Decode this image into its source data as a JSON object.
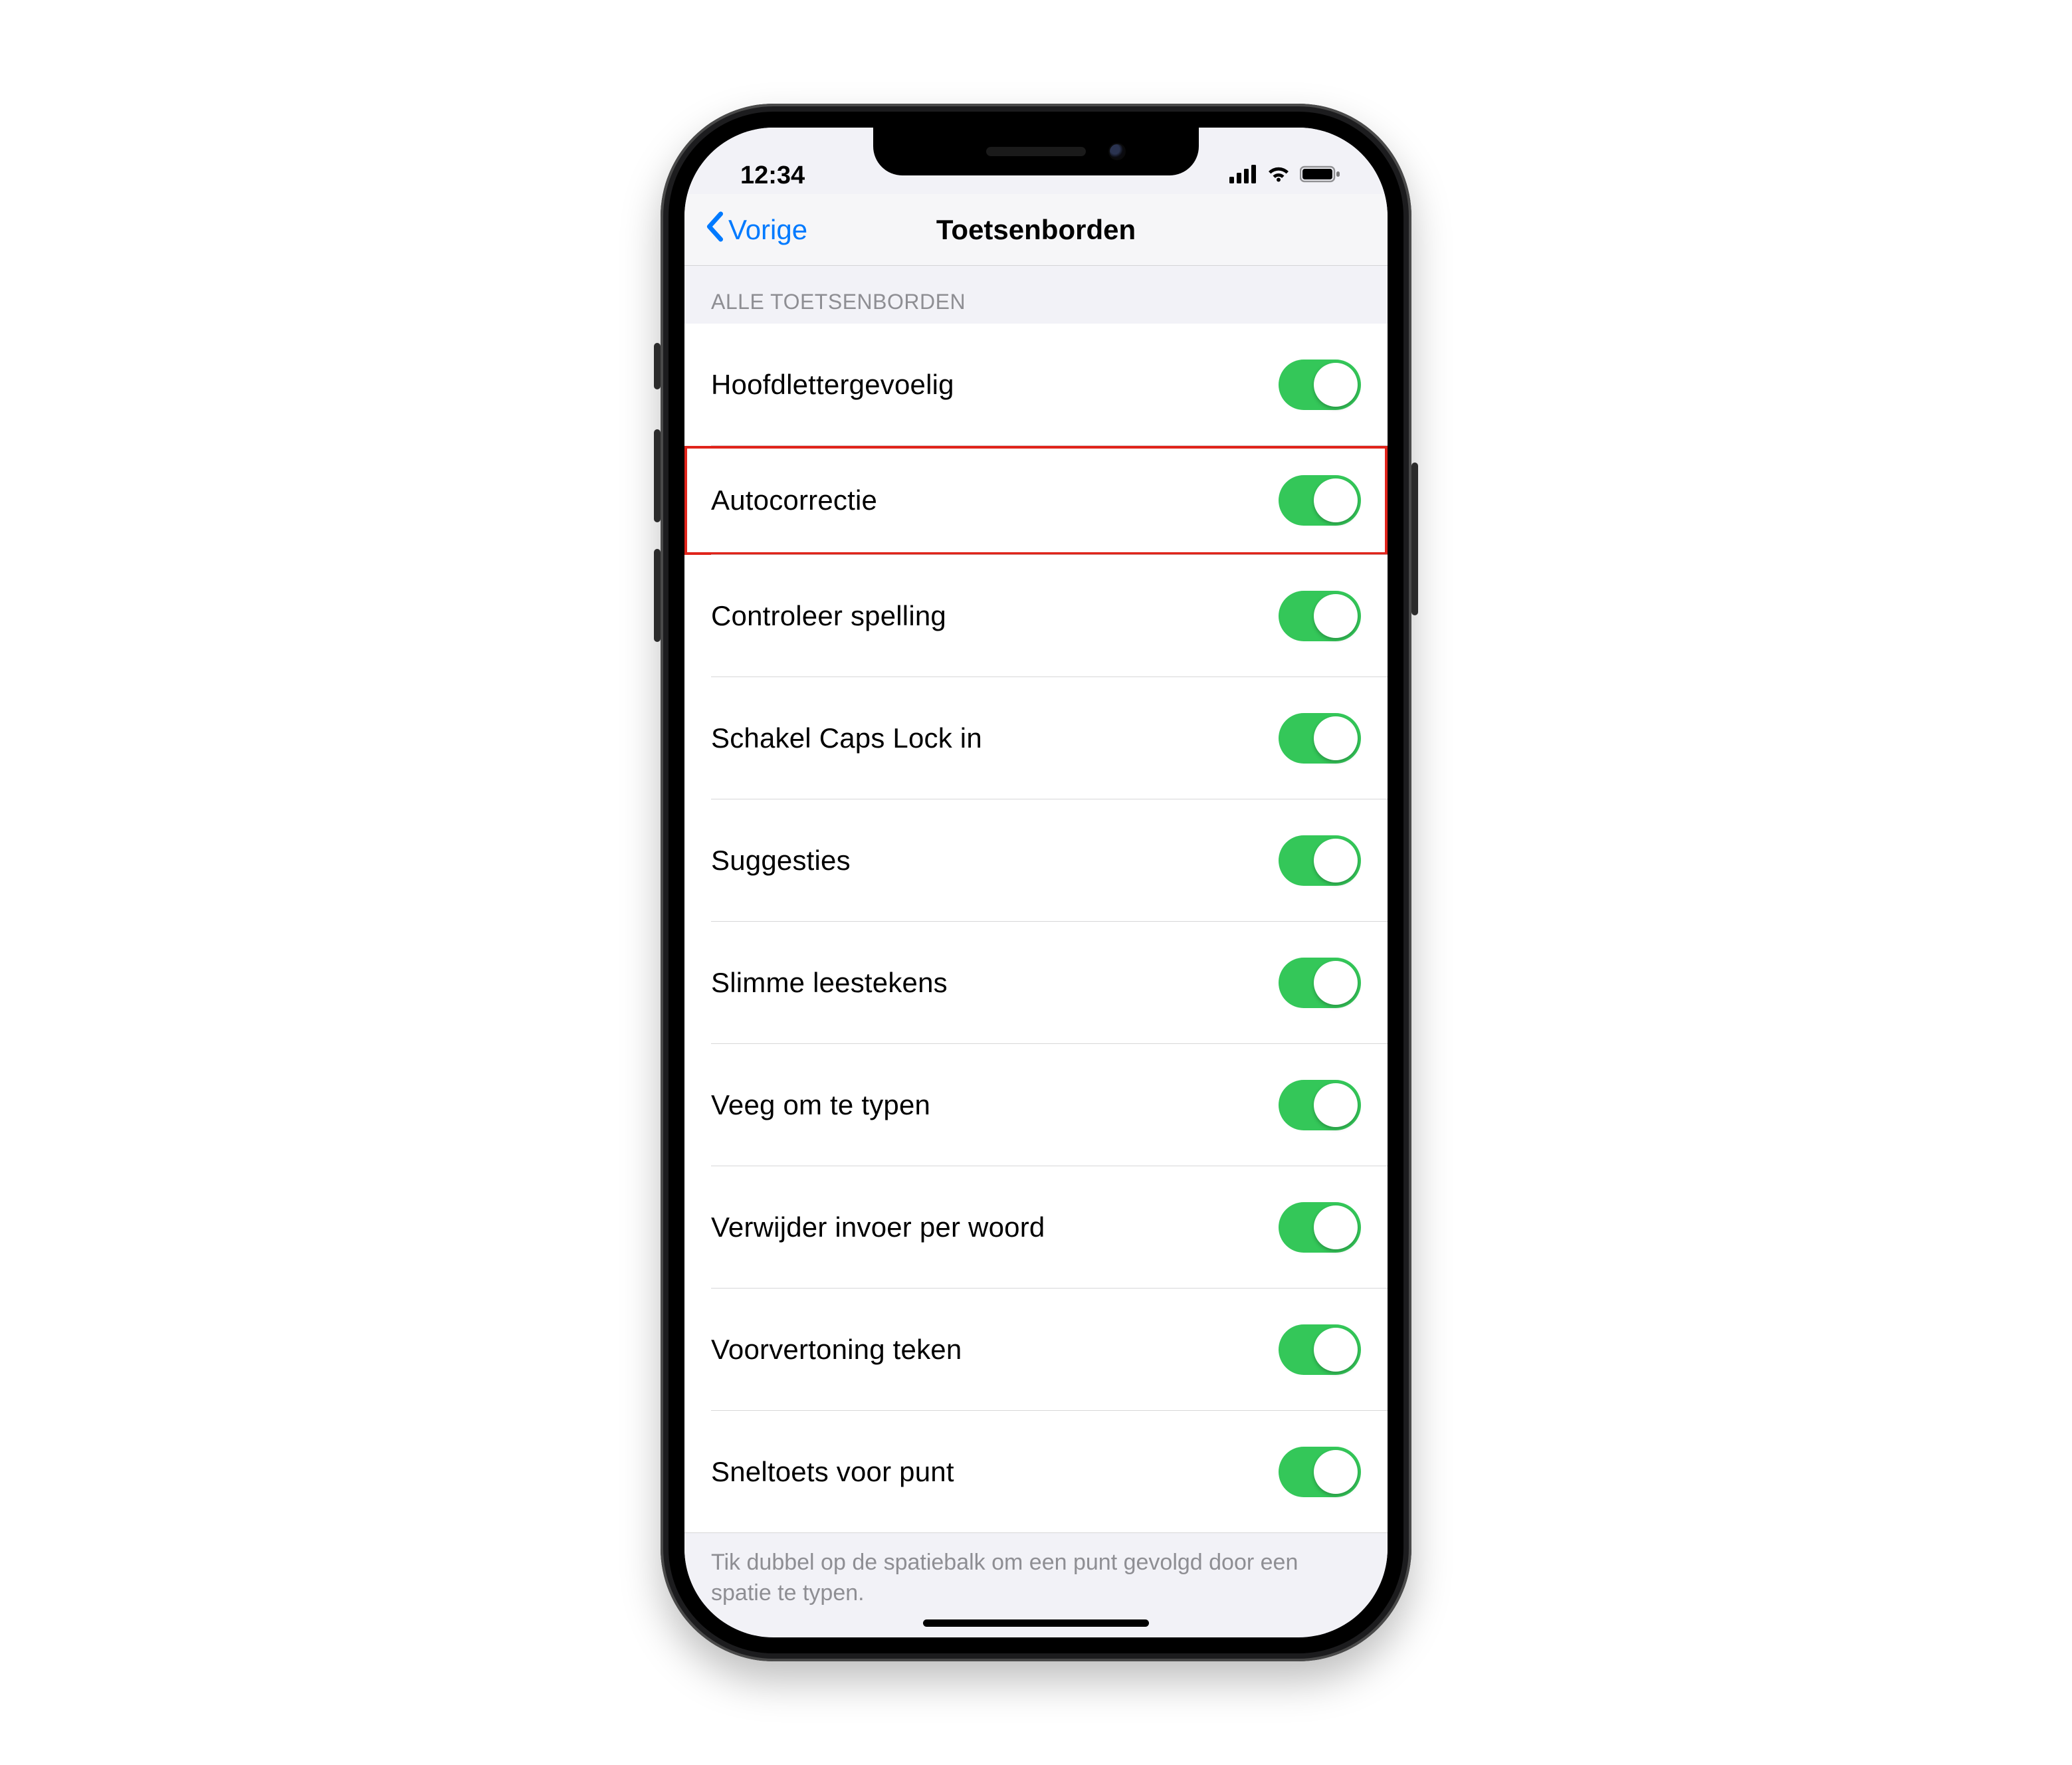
{
  "status": {
    "time": "12:34"
  },
  "nav": {
    "back_label": "Vorige",
    "title": "Toetsenborden"
  },
  "section": {
    "header": "ALLE TOETSENBORDEN",
    "footer": "Tik dubbel op de spatiebalk om een punt gevolgd door een spatie te typen."
  },
  "rows": [
    {
      "label": "Hoofdlettergevoelig",
      "on": true,
      "highlighted": false
    },
    {
      "label": "Autocorrectie",
      "on": true,
      "highlighted": true
    },
    {
      "label": "Controleer spelling",
      "on": true,
      "highlighted": false
    },
    {
      "label": "Schakel Caps Lock in",
      "on": true,
      "highlighted": false
    },
    {
      "label": "Suggesties",
      "on": true,
      "highlighted": false
    },
    {
      "label": "Slimme leestekens",
      "on": true,
      "highlighted": false
    },
    {
      "label": "Veeg om te typen",
      "on": true,
      "highlighted": false
    },
    {
      "label": "Verwijder invoer per woord",
      "on": true,
      "highlighted": false
    },
    {
      "label": "Voorvertoning teken",
      "on": true,
      "highlighted": false
    },
    {
      "label": "Sneltoets voor punt",
      "on": true,
      "highlighted": false
    }
  ],
  "colors": {
    "accent": "#007aff",
    "switch_on": "#34c759",
    "highlight": "#e0241b"
  }
}
